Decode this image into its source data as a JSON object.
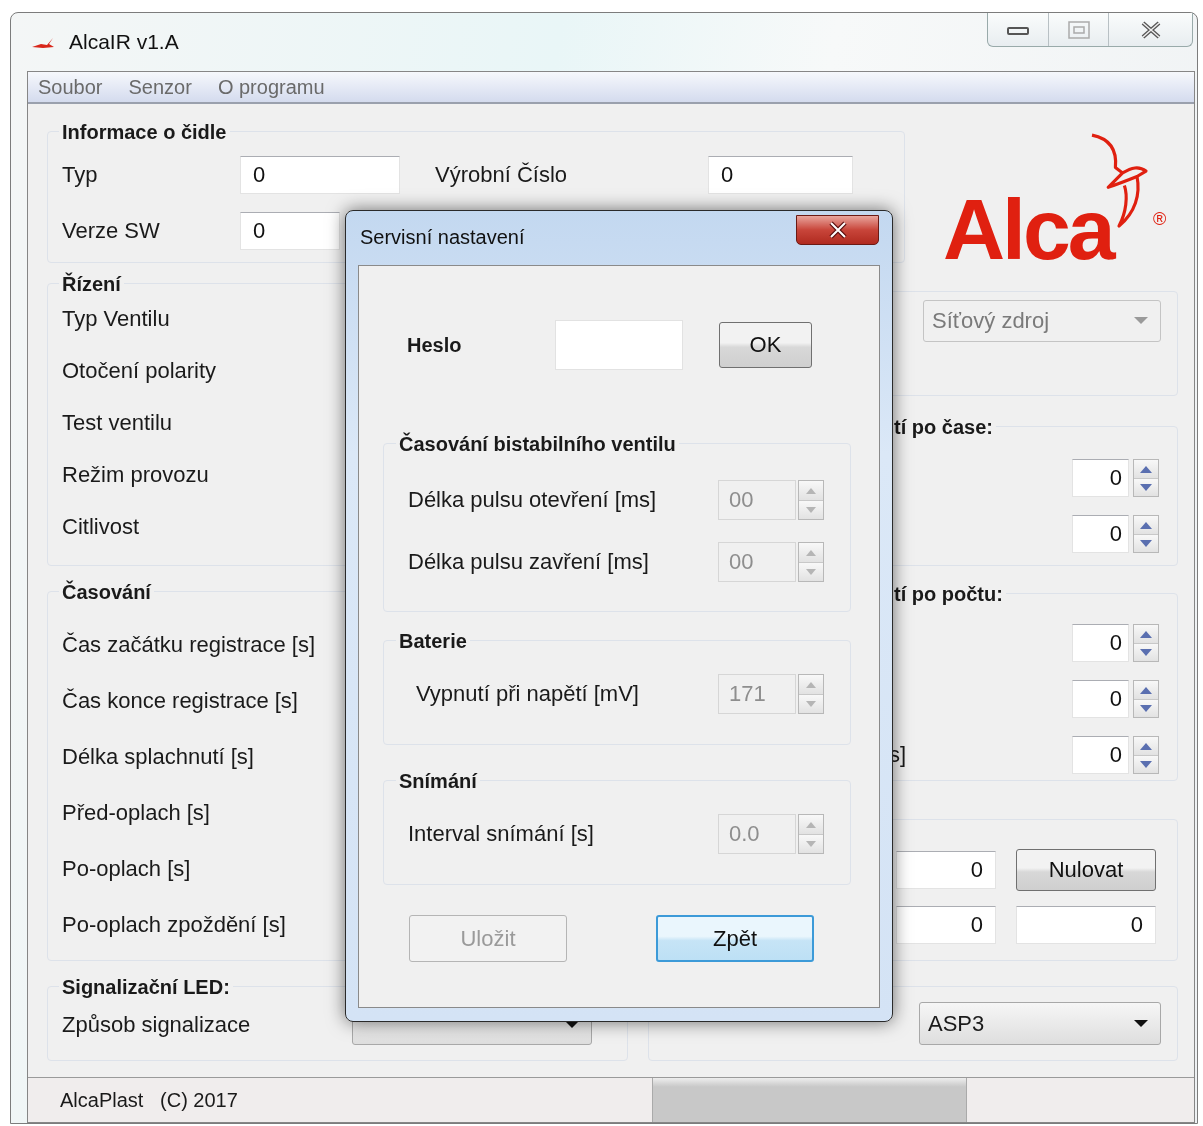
{
  "window": {
    "title": "AlcaIR  v1.A"
  },
  "menu": [
    "Soubor",
    "Senzor",
    "O programu"
  ],
  "sensor_info": {
    "title": "Informace o čidle",
    "fields": [
      {
        "label": "Typ",
        "value": "0"
      },
      {
        "label": "Výrobní Číslo",
        "value": "0"
      },
      {
        "label": "Verze SW",
        "value": "0"
      }
    ]
  },
  "logo": {
    "text": "Alca",
    "mark": "®"
  },
  "control": {
    "title": "Řízení",
    "rows": [
      "Typ Ventilu",
      "Otočení polarity",
      "Test ventilu",
      "Režim provozu",
      "Citlivost"
    ],
    "power_source": {
      "value": "Síťový zdroj",
      "disabled": true
    }
  },
  "time_group": {
    "title": "tí po čase:",
    "spinners": [
      {
        "value": "0"
      },
      {
        "value": "0"
      }
    ]
  },
  "count_group": {
    "title": "tí po počtu:",
    "spinners": [
      {
        "value": "0"
      },
      {
        "value": "0"
      },
      {
        "label": "s]",
        "value": "0"
      }
    ]
  },
  "counter_group": {
    "fields": [
      "0",
      "0",
      "0"
    ],
    "button": "Nulovat"
  },
  "timing": {
    "title": "Časování",
    "rows": [
      "Čas začátku registrace [s]",
      "Čas konce registrace [s]",
      "Délka splachnutí [s]",
      "Před-oplach [s]",
      "Po-oplach [s]",
      "Po-oplach zpoždění [s]"
    ]
  },
  "led": {
    "title": "Signalizační LED:",
    "label": "Způsob signalizace"
  },
  "preset": {
    "value": "ASP3"
  },
  "status_bar": {
    "text": "AlcaPlast   (C) 2017"
  },
  "dialog": {
    "title": "Servisní nastavení",
    "password": {
      "label": "Heslo",
      "button": "OK"
    },
    "groups": [
      {
        "title": "Časování bistabilního ventilu",
        "rows": [
          {
            "label": "Délka pulsu otevření [ms]",
            "value": "00",
            "disabled": true
          },
          {
            "label": "Délka pulsu zavření [ms]",
            "value": "00",
            "disabled": true
          }
        ]
      },
      {
        "title": "Baterie",
        "rows": [
          {
            "label": "Vypnutí při napětí [mV]",
            "value": "171",
            "disabled": true
          }
        ]
      },
      {
        "title": "Snímání",
        "rows": [
          {
            "label": "Interval snímání [s]",
            "value": "0.0",
            "disabled": true
          }
        ]
      }
    ],
    "buttons": [
      {
        "label": "Uložit",
        "disabled": true,
        "default": false
      },
      {
        "label": "Zpět",
        "disabled": false,
        "default": true
      }
    ]
  }
}
